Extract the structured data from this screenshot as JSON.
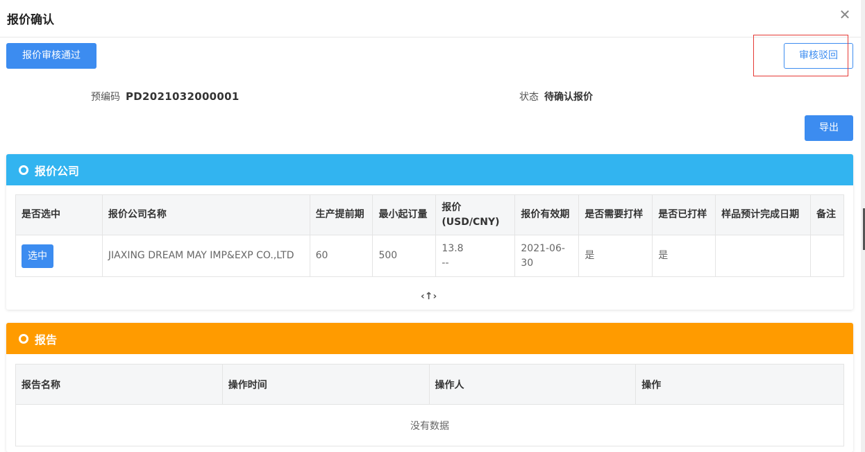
{
  "dialog": {
    "title": "报价确认",
    "close_icon": "close-icon"
  },
  "toolbar": {
    "approve_label": "报价审核通过",
    "reject_label": "审核驳回",
    "export_label": "导出"
  },
  "info": {
    "code_label": "预编码",
    "code_value": "PD2021032000001",
    "status_label": "状态",
    "status_value": "待确认报价"
  },
  "company_panel": {
    "title": "报价公司",
    "columns": [
      "是否选中",
      "报价公司名称",
      "生产提前期",
      "最小起订量",
      "报价\n(USD/CNY)",
      "报价有效期",
      "是否需要打样",
      "是否已打样",
      "样品预计完成日期",
      "备注"
    ],
    "rows": [
      {
        "select_label": "选中",
        "company": "JIAXING DREAM MAY IMP&EXP CO.,LTD",
        "lead_time": "60",
        "moq": "500",
        "price_usd": "13.8",
        "price_cny": "--",
        "valid_until": "2021-06-30",
        "need_sample": "是",
        "sampled": "是",
        "sample_date": "",
        "remark": ""
      }
    ],
    "scroll_icon": "‹↑›"
  },
  "report_panel": {
    "title": "报告",
    "columns": [
      "报告名称",
      "操作时间",
      "操作人",
      "操作"
    ],
    "empty_text": "没有数据"
  },
  "colors": {
    "primary": "#3c8cf0",
    "company_header": "#32b4f0",
    "report_header": "#ff9b00",
    "highlight_outline": "#e53935"
  }
}
